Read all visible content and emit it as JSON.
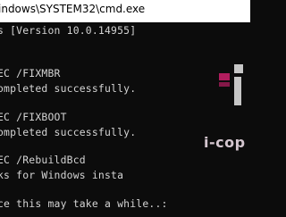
{
  "window": {
    "title": "indows\\SYSTEM32\\cmd.exe"
  },
  "console": {
    "lines": [
      "s [Version 10.0.14955]",
      "EC /FIXMBR",
      "ompleted successfully.",
      "EC /FIXBOOT",
      "ompleted successfully.",
      "EC /RebuildBcd",
      "ks for Windows insta",
      "ce this may take a while..:"
    ]
  },
  "watermark": {
    "text": "i-cop",
    "color": "#e8237a"
  }
}
